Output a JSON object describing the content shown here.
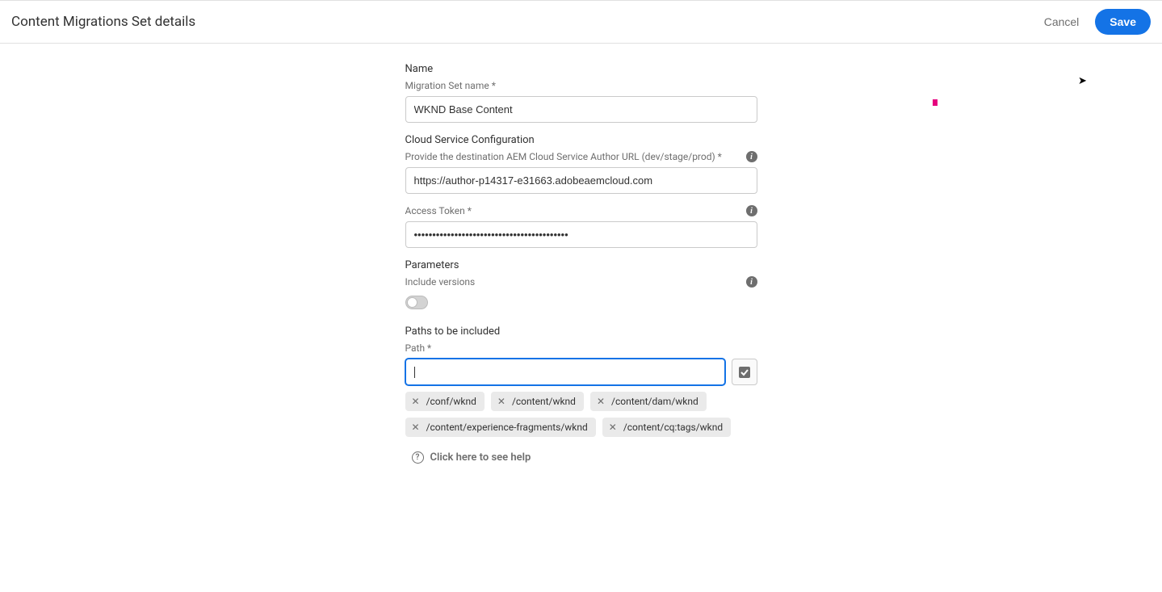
{
  "header": {
    "title": "Content Migrations Set details",
    "cancel": "Cancel",
    "save": "Save"
  },
  "sections": {
    "name": {
      "label": "Name",
      "field_label": "Migration Set name *",
      "value": "WKND Base Content"
    },
    "cloud": {
      "label": "Cloud Service Configuration",
      "url_label": "Provide the destination AEM Cloud Service Author URL (dev/stage/prod) *",
      "url_value": "https://author-p14317-e31663.adobeaemcloud.com",
      "token_label": "Access Token *",
      "token_value": "••••••••••••••••••••••••••••••••••••••••••"
    },
    "parameters": {
      "label": "Parameters",
      "versions_label": "Include versions"
    },
    "paths": {
      "label": "Paths to be included",
      "path_label": "Path *",
      "tags": [
        "/conf/wknd",
        "/content/wknd",
        "/content/dam/wknd",
        "/content/experience-fragments/wknd",
        "/content/cq:tags/wknd"
      ]
    },
    "help": "Click here to see help"
  }
}
